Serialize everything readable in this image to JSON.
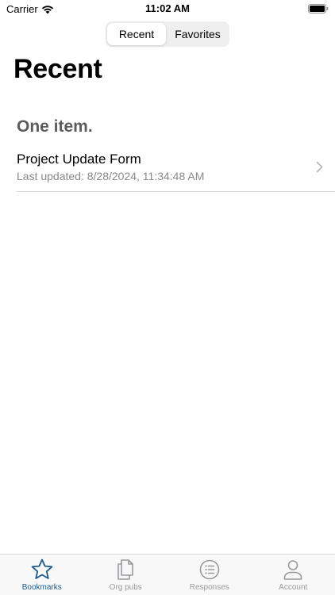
{
  "status_bar": {
    "carrier": "Carrier",
    "time": "11:02 AM"
  },
  "segmented_control": {
    "options": [
      {
        "label": "Recent",
        "selected": true
      },
      {
        "label": "Favorites",
        "selected": false
      }
    ]
  },
  "page": {
    "title": "Recent"
  },
  "section": {
    "header": "One item."
  },
  "list": {
    "items": [
      {
        "title": "Project Update Form",
        "subtitle": "Last updated: 8/28/2024, 11:34:48 AM"
      }
    ]
  },
  "tab_bar": {
    "active_color": "#1b5a8a",
    "inactive_color": "#9a9a9e",
    "tabs": [
      {
        "label": "Bookmarks",
        "icon": "star-icon",
        "active": true
      },
      {
        "label": "Org pubs",
        "icon": "documents-icon",
        "active": false
      },
      {
        "label": "Responses",
        "icon": "list-icon",
        "active": false
      },
      {
        "label": "Account",
        "icon": "person-icon",
        "active": false
      }
    ]
  }
}
